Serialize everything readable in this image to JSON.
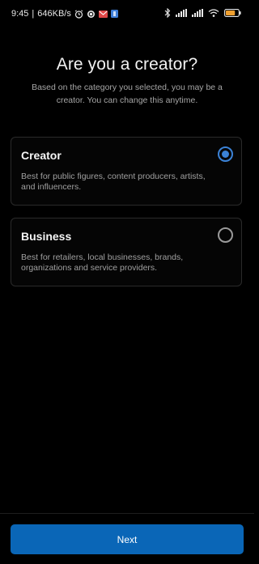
{
  "status_bar": {
    "time": "9:45",
    "separator": "|",
    "network_speed": "646KB/s",
    "left_icons": [
      "alarm-icon",
      "sync-icon",
      "mail-icon",
      "app-notification-icon"
    ],
    "right_icons": [
      "bluetooth-icon",
      "signal-icon",
      "signal-icon",
      "wifi-icon",
      "battery-icon"
    ],
    "battery_level": 0.75,
    "battery_color": "#f0a030"
  },
  "header": {
    "title": "Are you a creator?",
    "subtitle": "Based on the category you selected, you may be a creator. You can change this anytime."
  },
  "options": [
    {
      "title": "Creator",
      "description": "Best for public figures, content producers, artists, and influencers.",
      "selected": true
    },
    {
      "title": "Business",
      "description": "Best for retailers, local businesses, brands, organizations and service providers.",
      "selected": false
    }
  ],
  "footer": {
    "next_label": "Next"
  },
  "colors": {
    "accent": "#3b82d6",
    "button": "#0a66b7",
    "background": "#000000"
  }
}
